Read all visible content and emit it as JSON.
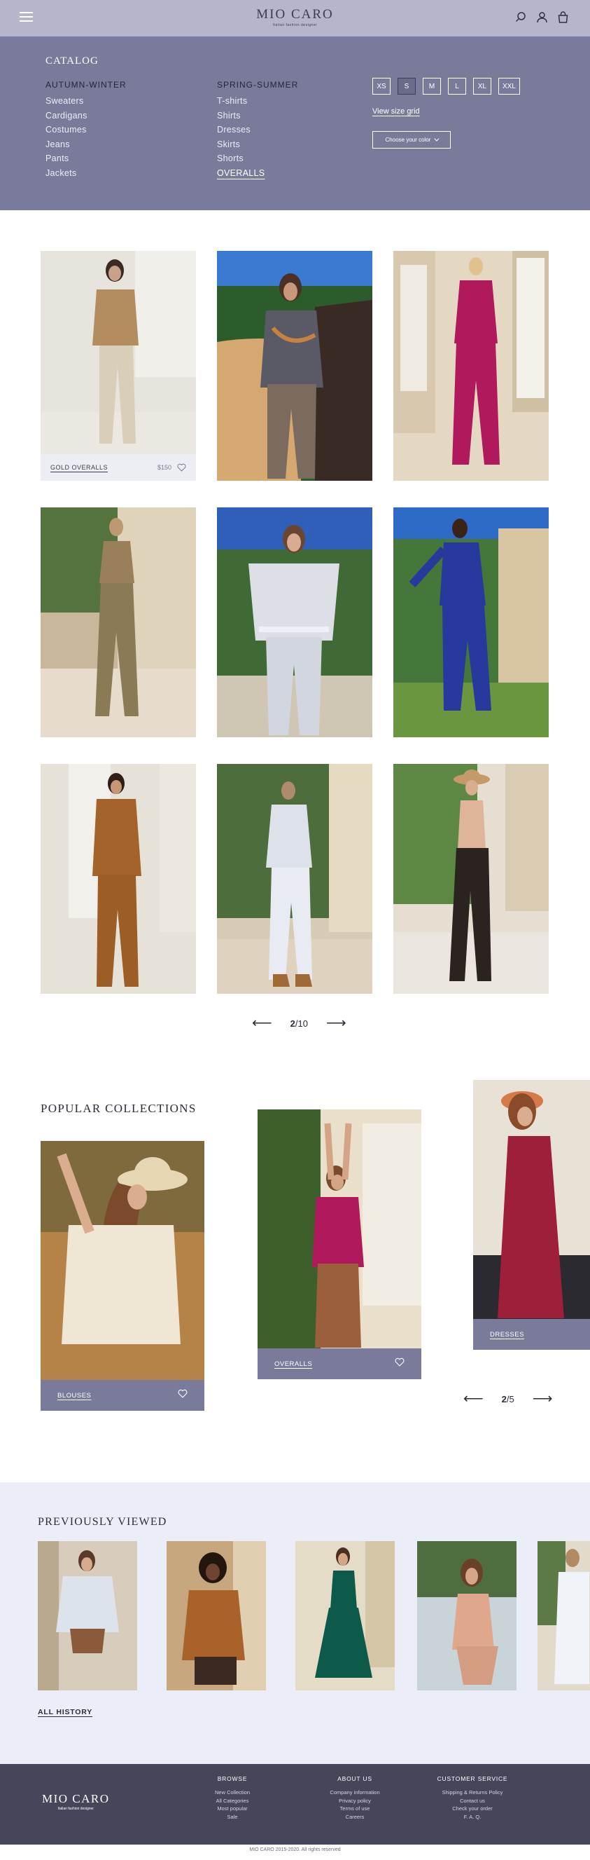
{
  "header": {
    "logo_name": "MIO CARO",
    "logo_tagline": "Italian fashion designer"
  },
  "catalog": {
    "title": "CATALOG",
    "autumn_winter": {
      "heading": "AUTUMN-WINTER",
      "items": [
        "Sweaters",
        "Cardigans",
        "Costumes",
        "Jeans",
        "Pants",
        "Jackets"
      ]
    },
    "spring_summer": {
      "heading": "SPRING-SUMMER",
      "items": [
        "T-shirts",
        "Shirts",
        "Dresses",
        "Skirts",
        "Shorts",
        "OVERALLS"
      ]
    },
    "sizes": [
      "XS",
      "S",
      "M",
      "L",
      "XL",
      "XXL"
    ],
    "size_grid_link": "View size grid",
    "color_select": "Choose your color"
  },
  "products": {
    "first_card": {
      "name": "GOLD OVERALLS",
      "price": "$150"
    },
    "pager": {
      "current": "2",
      "total": "/10"
    }
  },
  "popular": {
    "title": "POPULAR COLLECTIONS",
    "cards": [
      {
        "label": "BLOUSES"
      },
      {
        "label": "OVERALLS"
      },
      {
        "label": "DRESSES"
      }
    ],
    "pager": {
      "current": "2",
      "total": "/5"
    }
  },
  "previously_viewed": {
    "title": "PREVIOUSLY VIEWED",
    "all_history": "ALL HISTORY"
  },
  "footer": {
    "logo_name": "MIO CARO",
    "logo_tagline": "Italian fashion designer",
    "browse": {
      "heading": "BROWSE",
      "links": [
        "New Collection",
        "All Categories",
        "Most popular",
        "Sale"
      ]
    },
    "about": {
      "heading": "ABOUT US",
      "links": [
        "Company information",
        "Privacy policy",
        "Terms of use",
        "Careers"
      ]
    },
    "service": {
      "heading": "CUSTOMER SERVICE",
      "links": [
        "Shipping & Returns Policy",
        "Contact us",
        "Check your order",
        "F. A. Q."
      ]
    },
    "copyright": "MIO CARO 2015-2020. All rights reserved"
  },
  "colors": {
    "header_bg": "#b5b6cc",
    "catalog_bg": "#7a7b9b",
    "prev_bg": "#eceef7",
    "footer_bg": "#454659"
  }
}
